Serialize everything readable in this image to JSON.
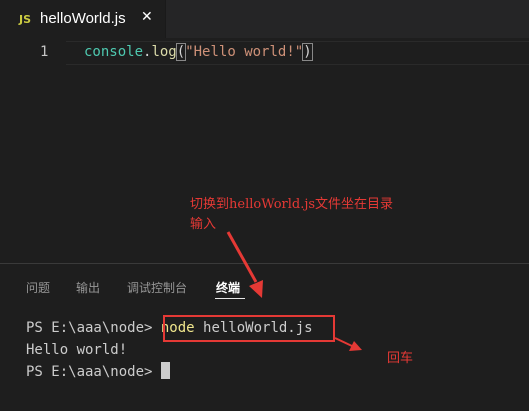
{
  "tab": {
    "icon": "JS",
    "title": "helloWorld.js",
    "close": "✕"
  },
  "editor": {
    "line_number": "1",
    "code": {
      "ident": "console",
      "dot": ".",
      "fn": "log",
      "open": "(",
      "str": "\"Hello world!\"",
      "close": ")"
    }
  },
  "annotations": {
    "top_line1": "切换到helloWorld.js文件坐在目录",
    "top_line2": "输入",
    "enter": "回车"
  },
  "panel": {
    "tabs": [
      "问题",
      "输出",
      "调试控制台",
      "终端"
    ],
    "active_tab": "终端"
  },
  "terminal": {
    "prompt1": "PS E:\\aaa\\node>",
    "cmd_node": "node",
    "cmd_rest": " helloWorld.js",
    "output": "Hello world!",
    "prompt2": "PS E:\\aaa\\node>"
  },
  "colors": {
    "annotation": "#e53935",
    "js_icon": "#cbcb41",
    "command": "#f0e68c"
  }
}
